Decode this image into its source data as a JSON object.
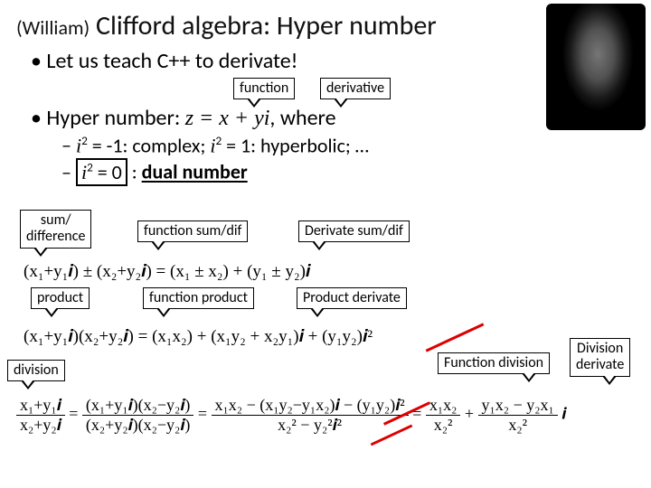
{
  "title_prefix": "(William)",
  "title_main": "Clifford algebra: Hyper number",
  "bullets": {
    "b1": "Let us teach C++ to derivate!",
    "b2_pre": "Hyper number: ",
    "b2_eq": "z = x + yi",
    "b2_post": ", where",
    "s1a": "i",
    "s1b": " = -1: complex; ",
    "s1c": "i",
    "s1d": " = 1: hyperbolic; …",
    "s2a": "i",
    "s2b": " = 0",
    "s2c": " : ",
    "s2d": "dual number"
  },
  "callouts": {
    "function": "function",
    "derivative": "derivative",
    "sumdiff": "sum/\ndifference",
    "func_sumdif": "function sum/dif",
    "deriv_sumdif": "Derivate sum/dif",
    "product": "product",
    "func_product": "function product",
    "prod_derivate": "Product derivate",
    "division": "division",
    "func_division": "Function division",
    "div_derivate": "Division\nderivate"
  },
  "equations": {
    "sum": "(x₁+y₁𝒊) ± (x₂+y₂𝒊) = (x₁ ± x₂) + (y₁ ± y₂)𝒊",
    "prod": "(x₁+y₁𝒊)(x₂+y₂𝒊) = (x₁x₂) + (x₁y₂ + x₂y₁)𝒊 + (y₁y₂)𝒊²",
    "div_lhs_num": "x₁+y₁𝒊",
    "div_lhs_den": "x₂+y₂𝒊",
    "div_mid_num": "(x₁+y₁𝒊)(x₂−y₂𝒊)",
    "div_mid_den": "(x₂+y₂𝒊)(x₂−y₂𝒊)",
    "div_r1_num": "x₁x₂ − (x₁y₂−y₁x₂)𝒊 − (y₁y₂)𝒊²",
    "div_r1_den": "x₂² − y₂²𝒊²",
    "div_r2_num1": "x₁x₂",
    "div_r2_num2": "y₁x₂ − y₂x₁",
    "div_r2_den": "x₂²"
  }
}
